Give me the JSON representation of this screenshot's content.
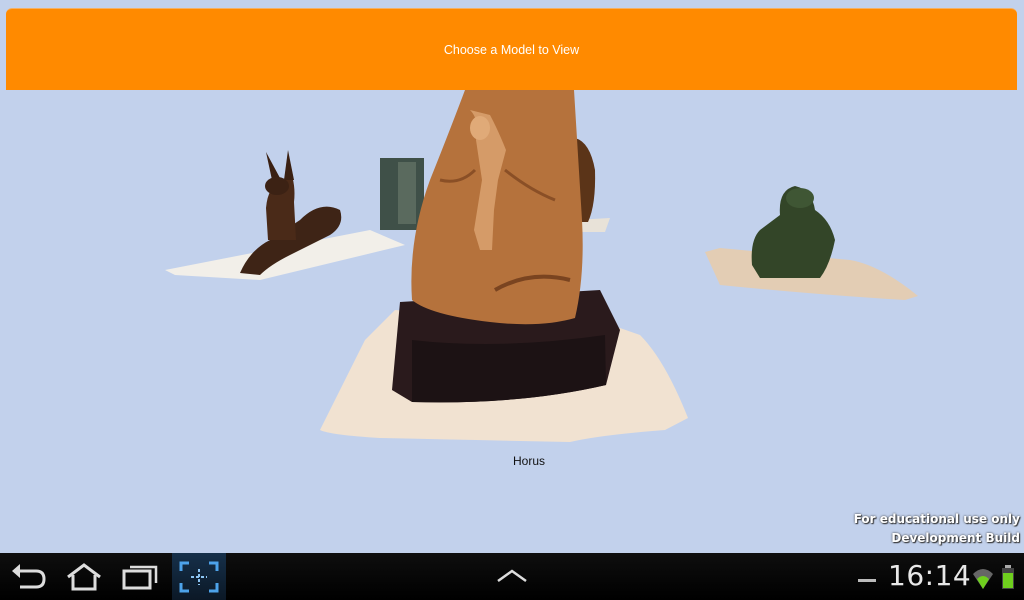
{
  "header": {
    "title": "Choose a Model to View"
  },
  "viewer": {
    "model_name": "Horus"
  },
  "watermark": {
    "line1": "For educational use only",
    "line2": "Development Build"
  },
  "navbar": {
    "icons": [
      "back-icon",
      "home-icon",
      "recent-apps-icon",
      "screenshot-icon",
      "menu-up-icon",
      "notification-dash-icon",
      "wifi-icon",
      "battery-icon"
    ],
    "clock": "16:14"
  },
  "colors": {
    "header": "#ff8a00",
    "background": "#c2d1ec",
    "navbar": "#000000"
  }
}
